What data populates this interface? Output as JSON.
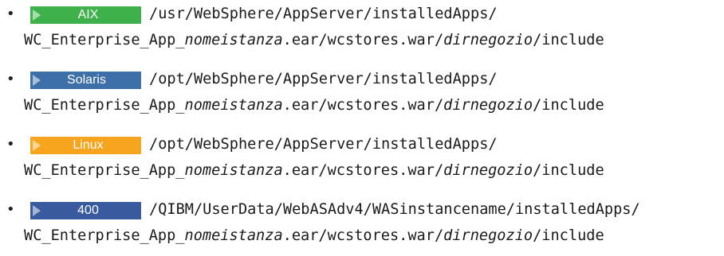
{
  "items": [
    {
      "badge": {
        "label": "AIX",
        "color": "#3fb14a"
      },
      "line1": "/usr/WebSphere/AppServer/installedApps/",
      "line2_prefix": "WC_Enterprise_App_",
      "line2_var1": "nomeistanza",
      "line2_middle": ".ear/wcstores.war/",
      "line2_var2": "dirnegozio",
      "line2_suffix": "/include"
    },
    {
      "badge": {
        "label": "Solaris",
        "color": "#3d6fa8"
      },
      "line1": "/opt/WebSphere/AppServer/installedApps/",
      "line2_prefix": "WC_Enterprise_App_",
      "line2_var1": "nomeistanza",
      "line2_middle": ".ear/wcstores.war/",
      "line2_var2": "dirnegozio",
      "line2_suffix": "/include"
    },
    {
      "badge": {
        "label": "Linux",
        "color": "#f7a51e"
      },
      "line1": "/opt/WebSphere/AppServer/installedApps/",
      "line2_prefix": "WC_Enterprise_App_",
      "line2_var1": "nomeistanza",
      "line2_middle": ".ear/wcstores.war/",
      "line2_var2": "dirnegozio",
      "line2_suffix": "/include"
    },
    {
      "badge": {
        "label": "400",
        "color": "#3a5aa0"
      },
      "line1": "/QIBM/UserData/WebASAdv4/WASinstancename/installedApps/",
      "line2_prefix": "WC_Enterprise_App_",
      "line2_var1": "nomeistanza",
      "line2_middle": ".ear/wcstores.war/",
      "line2_var2": "dirnegozio",
      "line2_suffix": "/include"
    }
  ]
}
